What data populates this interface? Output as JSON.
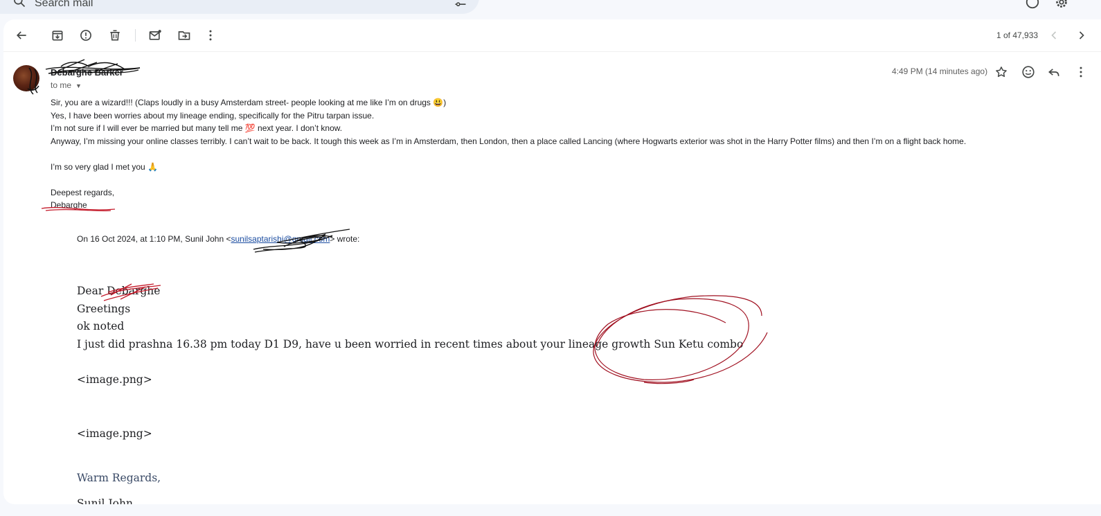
{
  "search": {
    "placeholder": "Search mail"
  },
  "toolbar": {
    "pagination": "1 of 47,933"
  },
  "message": {
    "sender_name": "Debarghe Barker",
    "recipient": "to me",
    "timestamp": "4:49 PM (14 minutes ago)",
    "body_lines": [
      "Sir, you are a wizard!!! (Claps loudly in a busy Amsterdam street- people looking at me like I’m on drugs 😃)",
      "Yes, I have been worries about my lineage ending, specifically for the Pitru tarpan issue.",
      "I’m not sure if I will ever be married but many tell me 💯 next year. I don’t know.",
      "Anyway, I’m missing your online classes terribly. I can’t wait to be back. It tough this week as I’m in Amsterdam, then London, then a place called Lancing (where Hogwarts exterior was shot in the Harry Potter films) and then I’m on a flight back home."
    ],
    "glad_line": "I’m so very glad I met you 🙏",
    "regards": "Deepest regards,",
    "signature": "Debarghe"
  },
  "quote": {
    "header_prefix": "On 16 Oct 2024, at 1:10 PM, Sunil John <",
    "email": "sunilsaptarishi@gmail.com",
    "header_suffix": "> wrote:",
    "salutation": "Dear Debarghe",
    "greeting": "Greetings",
    "noted": "ok noted",
    "prashna_line": "I just did prashna 16.38 pm today D1 D9, have u been worried in recent times about your lineage growth Sun Ketu combo",
    "attachment_1": "<image.png>",
    "attachment_2": "<image.png>",
    "signoff": "Warm Regards,",
    "signoff_name": "Sunil John"
  },
  "colors": {
    "background": "#f6f8fc",
    "panel": "#ffffff",
    "link": "#1a4ca0",
    "scribble_red": "#b01020"
  }
}
